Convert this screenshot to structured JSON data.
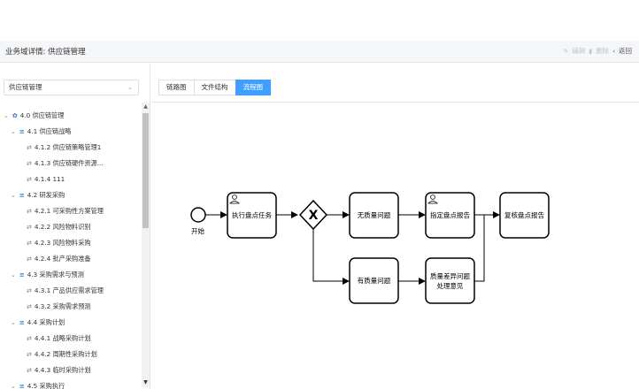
{
  "header": {
    "title": "业务域详情: 供应链管理",
    "edit_label": "编辑",
    "delete_label": "删除",
    "back_label": "返回"
  },
  "sidebar": {
    "select_value": "供应链管理",
    "tree": [
      {
        "label": "4.0 供应链管理",
        "level": 0,
        "type": "root",
        "expanded": true
      },
      {
        "label": "4.1 供应链战略",
        "level": 1,
        "type": "group",
        "expanded": true
      },
      {
        "label": "4.1.2 供应链策略管理1",
        "level": 2,
        "type": "leaf"
      },
      {
        "label": "4.1.3 供应链硬件资源...",
        "level": 2,
        "type": "leaf"
      },
      {
        "label": "4.1.4 111",
        "level": 2,
        "type": "leaf"
      },
      {
        "label": "4.2 研发采购",
        "level": 1,
        "type": "group",
        "expanded": true
      },
      {
        "label": "4.2.1 可采购性方案管理",
        "level": 2,
        "type": "leaf"
      },
      {
        "label": "4.2.2 风险物料识别",
        "level": 2,
        "type": "leaf"
      },
      {
        "label": "4.2.3 风险物料采购",
        "level": 2,
        "type": "leaf"
      },
      {
        "label": "4.2.4 批产采购准备",
        "level": 2,
        "type": "leaf"
      },
      {
        "label": "4.3 采购需求与预测",
        "level": 1,
        "type": "group",
        "expanded": true
      },
      {
        "label": "4.3.1 产品供应需求管理",
        "level": 2,
        "type": "leaf"
      },
      {
        "label": "4.3.2 采购需求预测",
        "level": 2,
        "type": "leaf"
      },
      {
        "label": "4.4 采购计划",
        "level": 1,
        "type": "group",
        "expanded": true
      },
      {
        "label": "4.4.1 战略采购计划",
        "level": 2,
        "type": "leaf"
      },
      {
        "label": "4.4.2 周期性采购计划",
        "level": 2,
        "type": "leaf"
      },
      {
        "label": "4.4.3 临时采购计划",
        "level": 2,
        "type": "leaf"
      },
      {
        "label": "4.5 采购执行",
        "level": 1,
        "type": "group",
        "expanded": true
      }
    ]
  },
  "tabs": [
    {
      "label": "链路图",
      "active": false
    },
    {
      "label": "文件结构",
      "active": false
    },
    {
      "label": "流程图",
      "active": true
    }
  ],
  "flow": {
    "start_label": "开始",
    "nodes": {
      "execute": "执行盘点任务",
      "no_quality": "无质量问题",
      "specify_report": "指定盘点报告",
      "review_report": "复核盘点报告",
      "has_quality": "有质量问题",
      "diff_line1": "质量差异问题",
      "diff_line2": "处理意见"
    },
    "gateway_symbol": "X"
  },
  "colors": {
    "accent": "#409eff",
    "tree_icon": "#2e7ddb"
  }
}
